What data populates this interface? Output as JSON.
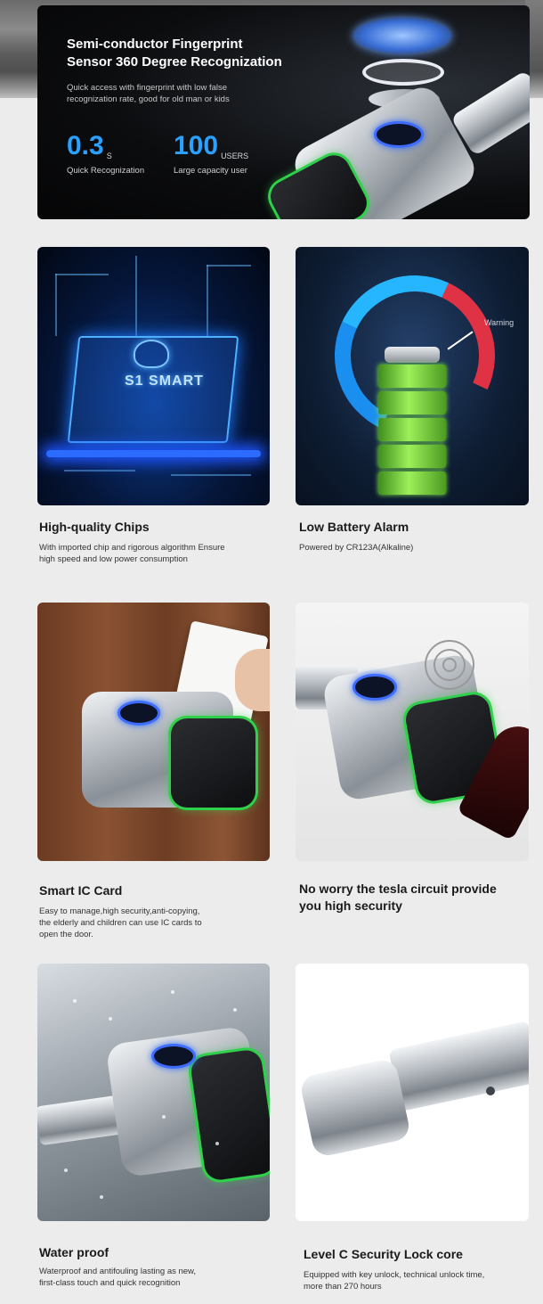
{
  "hero": {
    "title_line1": "Semi-conductor Fingerprint",
    "title_line2": "Sensor 360 Degree Recognization",
    "subtitle_line1": "Quick access with fingerprint with low false",
    "subtitle_line2": "recognization rate, good for old man or kids",
    "stat1": {
      "value": "0.3",
      "unit": "S",
      "label": "Quick Recognization"
    },
    "stat2": {
      "value": "100",
      "unit": "USERS",
      "label": "Large capacity user"
    }
  },
  "features": {
    "chips": {
      "image_text": "S1 SMART",
      "title": "High-quality Chips",
      "desc_line1": "With imported chip and rigorous algorithm Ensure",
      "desc_line2": "high speed and low power consumption"
    },
    "battery": {
      "warning_label": "Warning",
      "title": "Low Battery Alarm",
      "desc_line1": "Powered by CR123A(Alkaline)"
    },
    "ic_card": {
      "title": "Smart IC Card",
      "desc_line1": "Easy to manage,high security,anti-copying,",
      "desc_line2": "the elderly and children can use IC cards to",
      "desc_line3": "open the door."
    },
    "tesla": {
      "title_line1": "No worry the tesla circuit provide",
      "title_line2": "you high security"
    },
    "waterproof": {
      "title": "Water proof",
      "desc_line1": "Waterproof and antifouling lasting as new,",
      "desc_line2": "first-class touch and quick recognition"
    },
    "lock_core": {
      "title": "Level C Security Lock core",
      "desc_line1": "Equipped with  key unlock, technical unlock time,",
      "desc_line2": "more than 270 hours"
    }
  },
  "colors": {
    "accent_blue": "#2aa0ff",
    "led_green": "#2fd04a",
    "warning_red": "#e03245"
  }
}
